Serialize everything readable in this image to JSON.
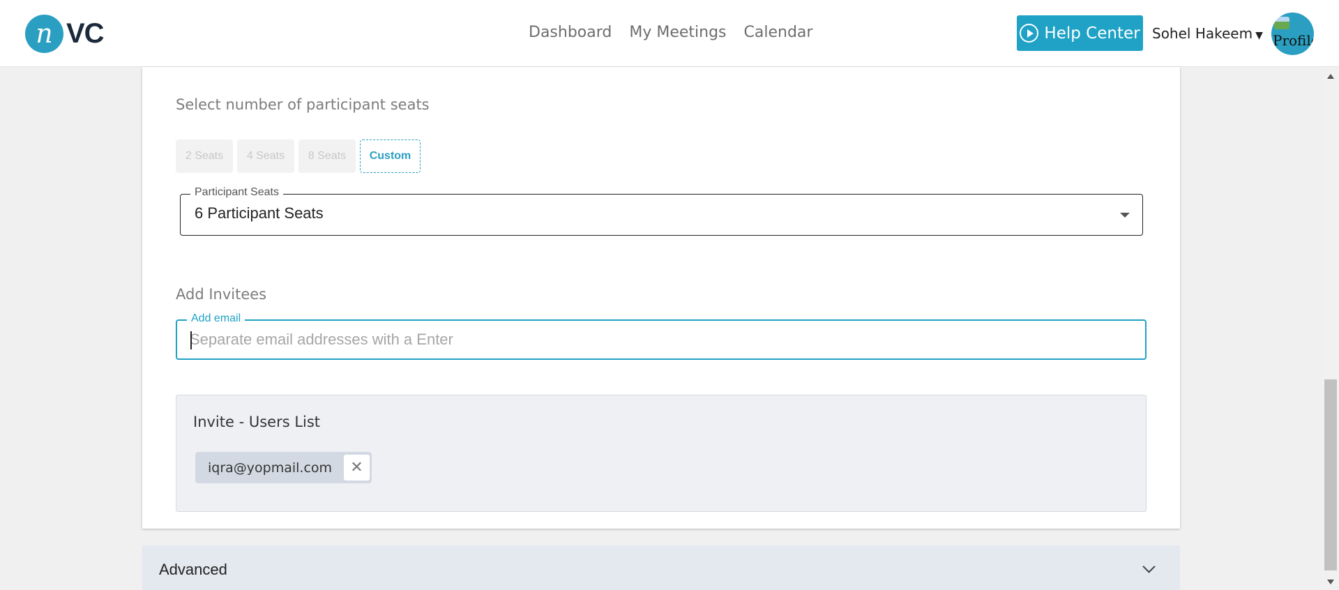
{
  "header": {
    "logo": {
      "mark": "n",
      "text": "VC"
    },
    "nav": [
      "Dashboard",
      "My Meetings",
      "Calendar"
    ],
    "help_center_label": "Help Center",
    "user_name": "Sohel Hakeem",
    "avatar_alt": "Profile"
  },
  "seats": {
    "section_label": "Select number of participant seats",
    "options": [
      "2 Seats",
      "4 Seats",
      "8 Seats",
      "Custom"
    ],
    "selected_option": "Custom",
    "field_label": "Participant Seats",
    "field_value": "6 Participant Seats"
  },
  "invitees": {
    "section_label": "Add Invitees",
    "email_label": "Add email",
    "email_placeholder": "Separate email addresses with a Enter",
    "email_value": "",
    "list_title": "Invite - Users List",
    "users": [
      "iqra@yopmail.com"
    ]
  },
  "advanced": {
    "label": "Advanced"
  },
  "colors": {
    "accent": "#1fa2c6",
    "logo_circle": "#2a9fc1",
    "logo_text": "#1a2a3c",
    "page_bg": "#f0f0f1",
    "invite_box_bg": "#eef0f4",
    "advanced_bg": "#e4e8ef"
  },
  "icons": {
    "help": "play-circle-icon",
    "user_menu": "caret-down-icon",
    "select": "dropdown-arrow-icon",
    "remove_chip": "close-icon",
    "advanced": "chevron-down-icon"
  }
}
